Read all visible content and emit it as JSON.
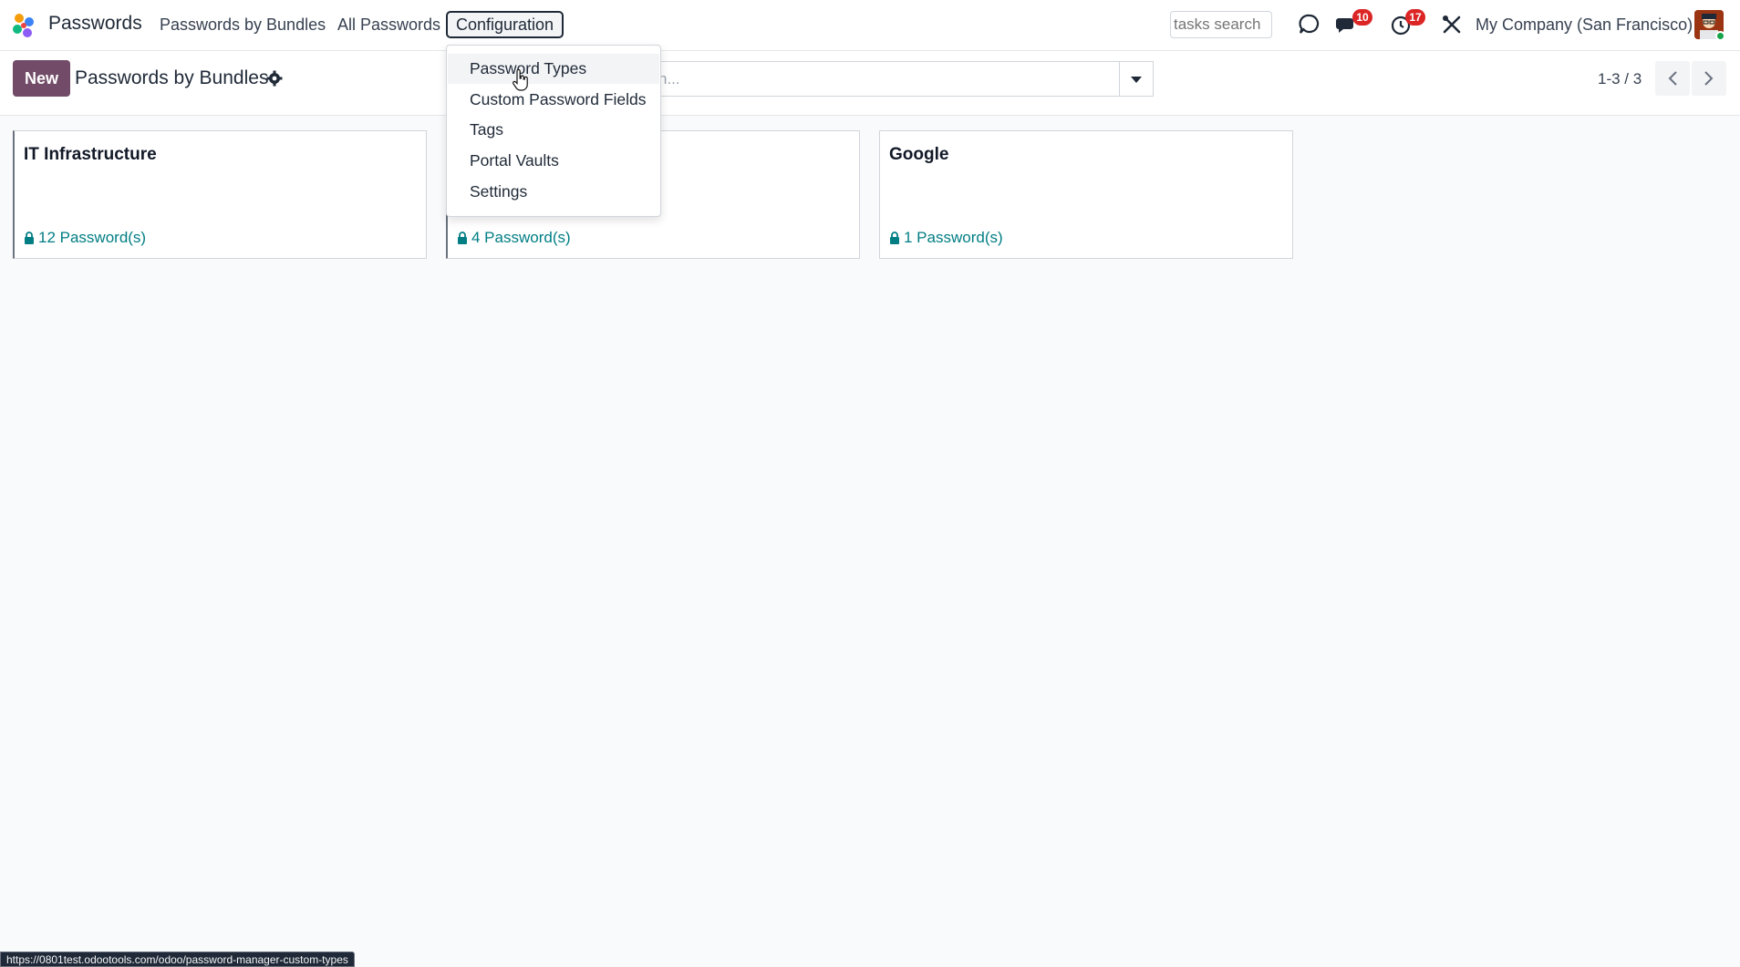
{
  "navbar": {
    "app_name": "Passwords",
    "menus": [
      "Passwords by Bundles",
      "All Passwords",
      "Configuration"
    ],
    "tasks_search_placeholder": "tasks search",
    "messages_badge": "10",
    "activities_badge": "17",
    "company": "My Company (San Francisco)"
  },
  "control_panel": {
    "new_label": "New",
    "title": "Passwords by Bundles",
    "search_placeholder": "h...",
    "pager": "1-3 / 3"
  },
  "cards": [
    {
      "title": "IT Infrastructure",
      "link": "12 Password(s)"
    },
    {
      "title": "",
      "link": "4 Password(s)"
    },
    {
      "title": "Google",
      "link": "1 Password(s)"
    }
  ],
  "dropdown": {
    "items": [
      "Password Types",
      "Custom Password Fields",
      "Tags",
      "Portal Vaults",
      "Settings"
    ],
    "active_index": 0
  },
  "status_url": "https://0801test.odootools.com/odoo/password-manager-custom-types",
  "colors": {
    "brand": "#714b67",
    "link": "#017e84",
    "badge": "#dc2626"
  }
}
